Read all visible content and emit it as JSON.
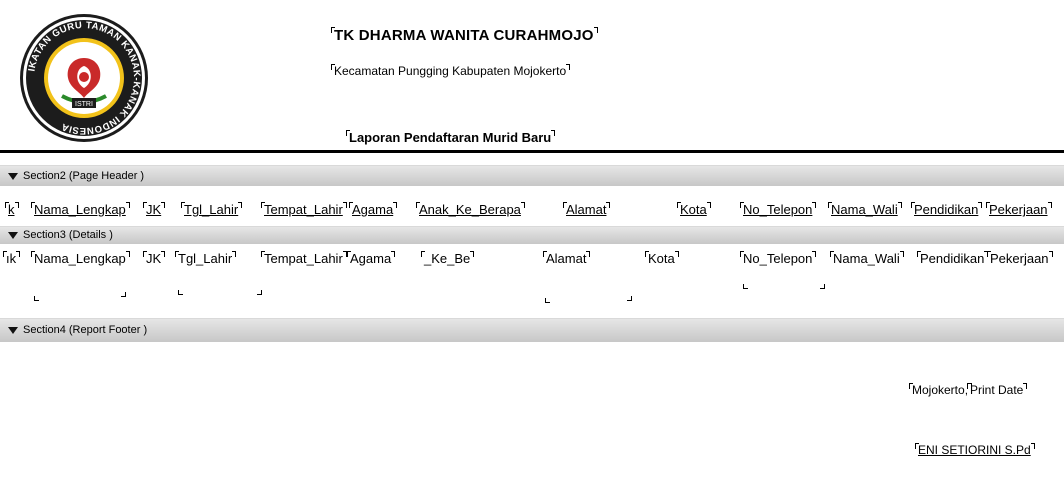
{
  "header": {
    "school_name": "TK DHARMA WANITA CURAHMOJO",
    "address": "Kecamatan Pungging Kabupaten Mojokerto",
    "report_title": "Laporan Pendaftaran Murid Baru",
    "logo": {
      "outer_text": "IKATAN GURU TAMAN KANAK-KANAK INDONESIA",
      "badge_text": "ISTRI",
      "colors": {
        "ring": "#1c1c1c",
        "accent": "#f2c21a",
        "emblem": "#c92a2a"
      }
    }
  },
  "sections": {
    "page_header": "Section2 (Page Header )",
    "details": "Section3 (Details )",
    "report_footer": "Section4 (Report Footer )"
  },
  "page_header_fields": {
    "col0": "k",
    "nama": "Nama_Lengkap",
    "jk": "JK",
    "tgl": "Tgl_Lahir",
    "tempat": "Tempat_Lahir",
    "agama": "Agama",
    "anak": "Anak_Ke_Berapa",
    "alamat": "Alamat",
    "kota": "Kota",
    "telepon": "No_Telepon",
    "wali": "Nama_Wali",
    "pendidikan": "Pendidikan",
    "pekerjaan": "Pekerjaan"
  },
  "detail_fields": {
    "col0": "ık",
    "nama": "Nama_Lengkap",
    "jk": "JK",
    "tgl": "Tgl_Lahir",
    "tempat": "Tempat_Lahir",
    "agama": "Agama",
    "anak": "_Ke_Be",
    "alamat": "Alamat",
    "kota": "Kota",
    "telepon": "No_Telepon",
    "wali": "Nama_Wali",
    "pendidikan": "Pendidikan",
    "pekerjaan": "Pekerjaan"
  },
  "footer": {
    "city": "Mojokerto,",
    "print_date": "Print Date",
    "signatory": "ENI SETIORINI S.Pd"
  }
}
